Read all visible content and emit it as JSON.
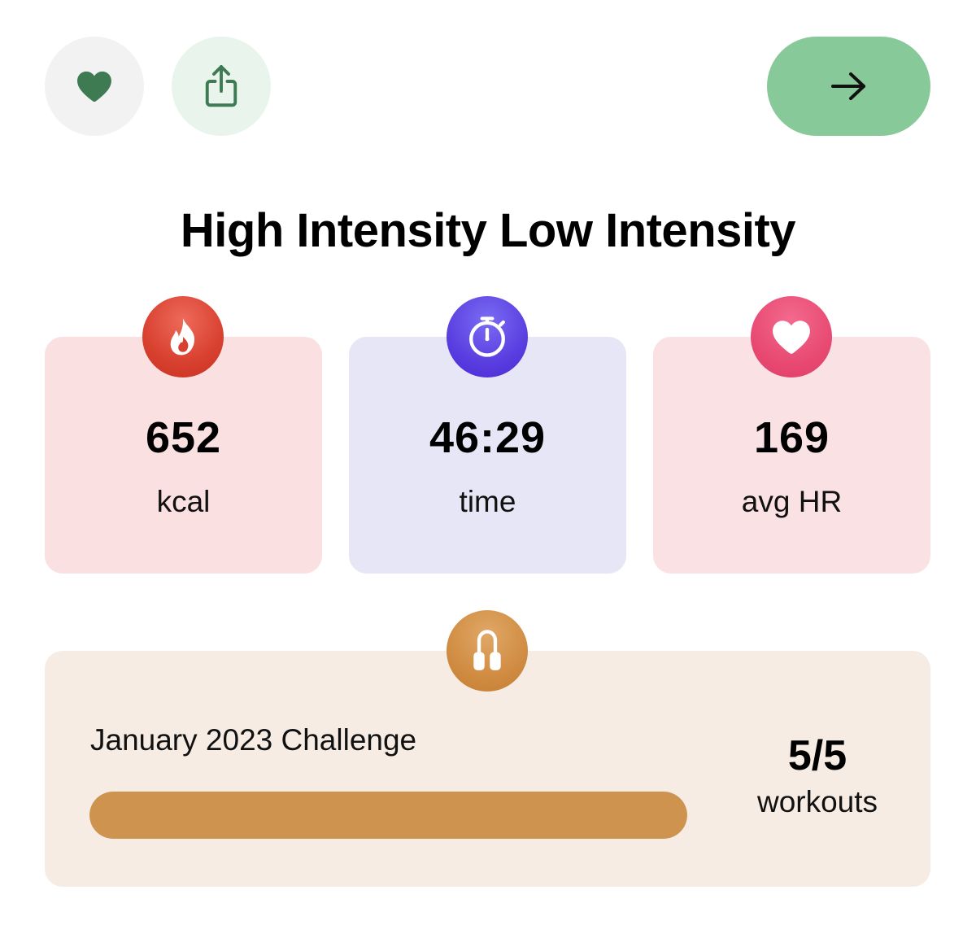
{
  "colors": {
    "accent_green": "#88c99a",
    "heart_green": "#3e7a52",
    "kcal_card": "#fae0e0",
    "time_card": "#e6e6f7",
    "hr_card": "#fae2e4",
    "challenge_card": "#f6ece4",
    "progress_fill": "#cf9350"
  },
  "toolbar": {
    "favorite_icon": "heart-icon",
    "share_icon": "share-icon",
    "next_icon": "arrow-right-icon"
  },
  "workout": {
    "title": "High Intensity Low Intensity"
  },
  "stats": [
    {
      "icon": "flame-icon",
      "value": "652",
      "label": "kcal"
    },
    {
      "icon": "stopwatch-icon",
      "value": "46:29",
      "label": "time"
    },
    {
      "icon": "heart-icon",
      "value": "169",
      "label": "avg HR"
    }
  ],
  "challenge": {
    "icon": "jump-rope-icon",
    "title": "January 2023 Challenge",
    "progress": 1.0,
    "count": "5/5",
    "count_label": "workouts"
  }
}
